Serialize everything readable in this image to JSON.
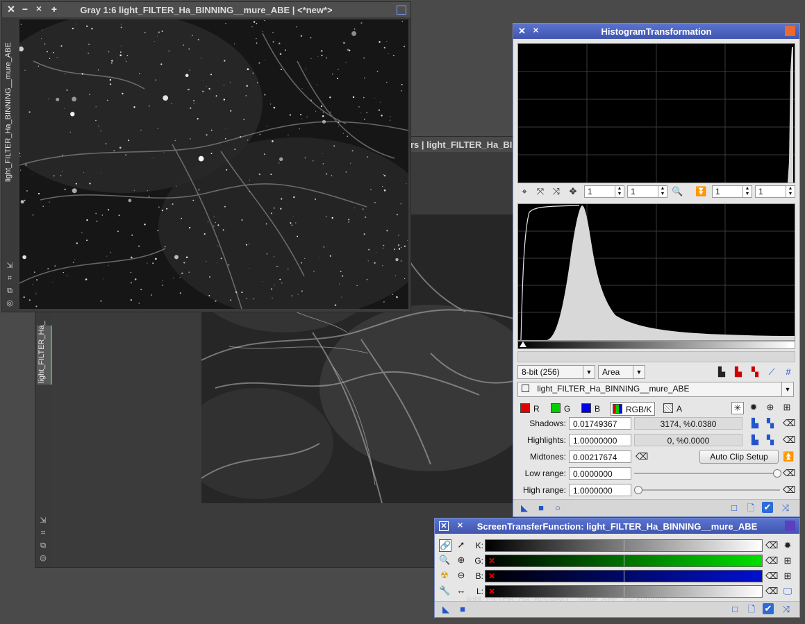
{
  "background_window": {
    "title_fragment": "rs | light_FILTER_Ha_BINNING__mure_ABE_starsremoved",
    "sidebar_label": "light_FILTER_Ha_"
  },
  "front_window": {
    "title": "Gray 1:6 light_FILTER_Ha_BINNING__mure_ABE | <*new*>",
    "sidebar_label": "light_FILTER_Ha_BINNING__mure_ABE"
  },
  "histogram": {
    "title": "HistogramTransformation",
    "zoom_h": "1",
    "zoom_v": "1",
    "zoom_h2": "1",
    "zoom_v2": "1",
    "resolution": "8-bit (256)",
    "graph_style": "Area",
    "view": "light_FILTER_Ha_BINNING__mure_ABE",
    "channels": [
      {
        "label": "R",
        "color": "#e00000"
      },
      {
        "label": "G",
        "color": "#00d000"
      },
      {
        "label": "B",
        "color": "#0000e0"
      },
      {
        "label": "RGB/K",
        "color": "#444444"
      },
      {
        "label": "A",
        "color": "#ffffff"
      }
    ],
    "shadows_label": "Shadows:",
    "shadows_value": "0.01749367",
    "shadows_clip": "3174, %0.0380",
    "highlights_label": "Highlights:",
    "highlights_value": "1.00000000",
    "highlights_clip": "0, %0.0000",
    "midtones_label": "Midtones:",
    "midtones_value": "0.00217674",
    "auto_clip_label": "Auto Clip Setup",
    "low_range_label": "Low range:",
    "low_range_value": "0.0000000",
    "low_range_slider": 1.0,
    "high_range_label": "High range:",
    "high_range_value": "1.0000000",
    "high_range_slider": 0.0
  },
  "stf": {
    "title": "ScreenTransferFunction: light_FILTER_Ha_BINNING__mure_ABE",
    "rows": [
      {
        "label": "K:",
        "color": "#ffffff",
        "disabled": false
      },
      {
        "label": "G:",
        "color": "#00e000",
        "disabled": true
      },
      {
        "label": "B:",
        "color": "#0010d0",
        "disabled": true
      },
      {
        "label": "L:",
        "color": "#ffffff",
        "disabled": true
      }
    ],
    "midtone_position": 0.5,
    "ghost_text": "light_FILTER_Ha_BINNING__mure_ABE_background"
  },
  "icons": {
    "close": "close-icon",
    "minimize": "minimize-icon",
    "shade": "shade-icon",
    "maximize": "maximize-icon"
  }
}
